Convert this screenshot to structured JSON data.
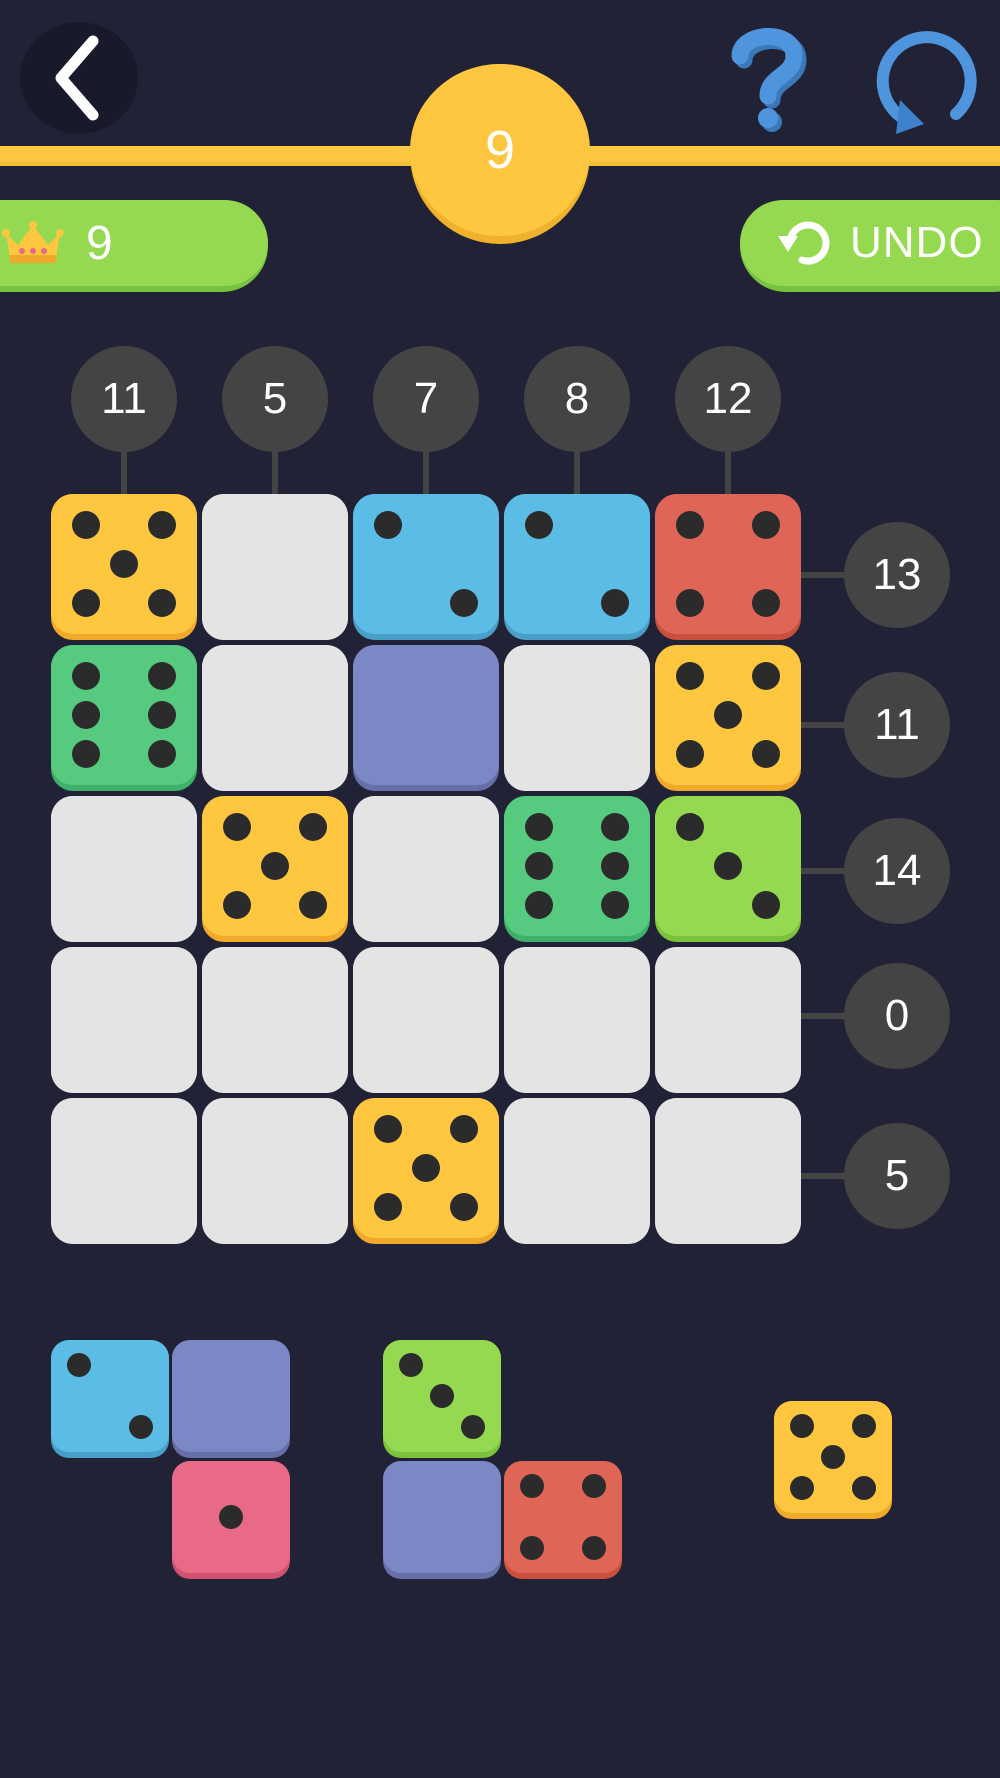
{
  "header": {
    "back_icon": "chevron-left-icon",
    "help_icon": "question-mark-icon",
    "restart_icon": "restart-icon",
    "level": "9"
  },
  "best": {
    "icon": "crown-icon",
    "value": "9"
  },
  "undo": {
    "icon": "undo-icon",
    "label": "UNDO"
  },
  "column_targets": [
    "11",
    "5",
    "7",
    "8",
    "12"
  ],
  "row_targets": [
    "13",
    "11",
    "14",
    "0",
    "5"
  ],
  "colors": {
    "background": "#212235",
    "empty": "#e4e4e4",
    "yellow": "#ffc63f",
    "blue": "#5bbde6",
    "red": "#df6656",
    "green": "#56cb80",
    "lime": "#94d94f",
    "purple": "#7c88c6",
    "pink": "#e86a86",
    "accent_gold": "#ffc63f",
    "accent_green": "#94d94f"
  },
  "board": [
    [
      {
        "color": "yellow",
        "pips": 5
      },
      {
        "color": "empty",
        "pips": 0
      },
      {
        "color": "blue",
        "pips": 2
      },
      {
        "color": "blue",
        "pips": 2
      },
      {
        "color": "red",
        "pips": 4
      }
    ],
    [
      {
        "color": "green",
        "pips": 6
      },
      {
        "color": "empty",
        "pips": 0
      },
      {
        "color": "purple",
        "pips": 0
      },
      {
        "color": "empty",
        "pips": 0
      },
      {
        "color": "yellow",
        "pips": 5
      }
    ],
    [
      {
        "color": "empty",
        "pips": 0
      },
      {
        "color": "yellow",
        "pips": 5
      },
      {
        "color": "empty",
        "pips": 0
      },
      {
        "color": "green",
        "pips": 6
      },
      {
        "color": "lime",
        "pips": 3
      }
    ],
    [
      {
        "color": "empty",
        "pips": 0
      },
      {
        "color": "empty",
        "pips": 0
      },
      {
        "color": "empty",
        "pips": 0
      },
      {
        "color": "empty",
        "pips": 0
      },
      {
        "color": "empty",
        "pips": 0
      }
    ],
    [
      {
        "color": "empty",
        "pips": 0
      },
      {
        "color": "empty",
        "pips": 0
      },
      {
        "color": "yellow",
        "pips": 5
      },
      {
        "color": "empty",
        "pips": 0
      },
      {
        "color": "empty",
        "pips": 0
      }
    ]
  ],
  "pieces": [
    {
      "dice": [
        {
          "r": 0,
          "c": 0,
          "color": "blue",
          "pips": 2
        },
        {
          "r": 0,
          "c": 1,
          "color": "purple",
          "pips": 0
        },
        {
          "r": 1,
          "c": 1,
          "color": "pink",
          "pips": 1
        }
      ]
    },
    {
      "dice": [
        {
          "r": 0,
          "c": 0,
          "color": "lime",
          "pips": 3
        },
        {
          "r": 1,
          "c": 0,
          "color": "purple",
          "pips": 0
        },
        {
          "r": 1,
          "c": 1,
          "color": "red",
          "pips": 4
        }
      ]
    },
    {
      "dice": [
        {
          "r": 0,
          "c": 0,
          "color": "yellow",
          "pips": 5
        }
      ]
    }
  ]
}
